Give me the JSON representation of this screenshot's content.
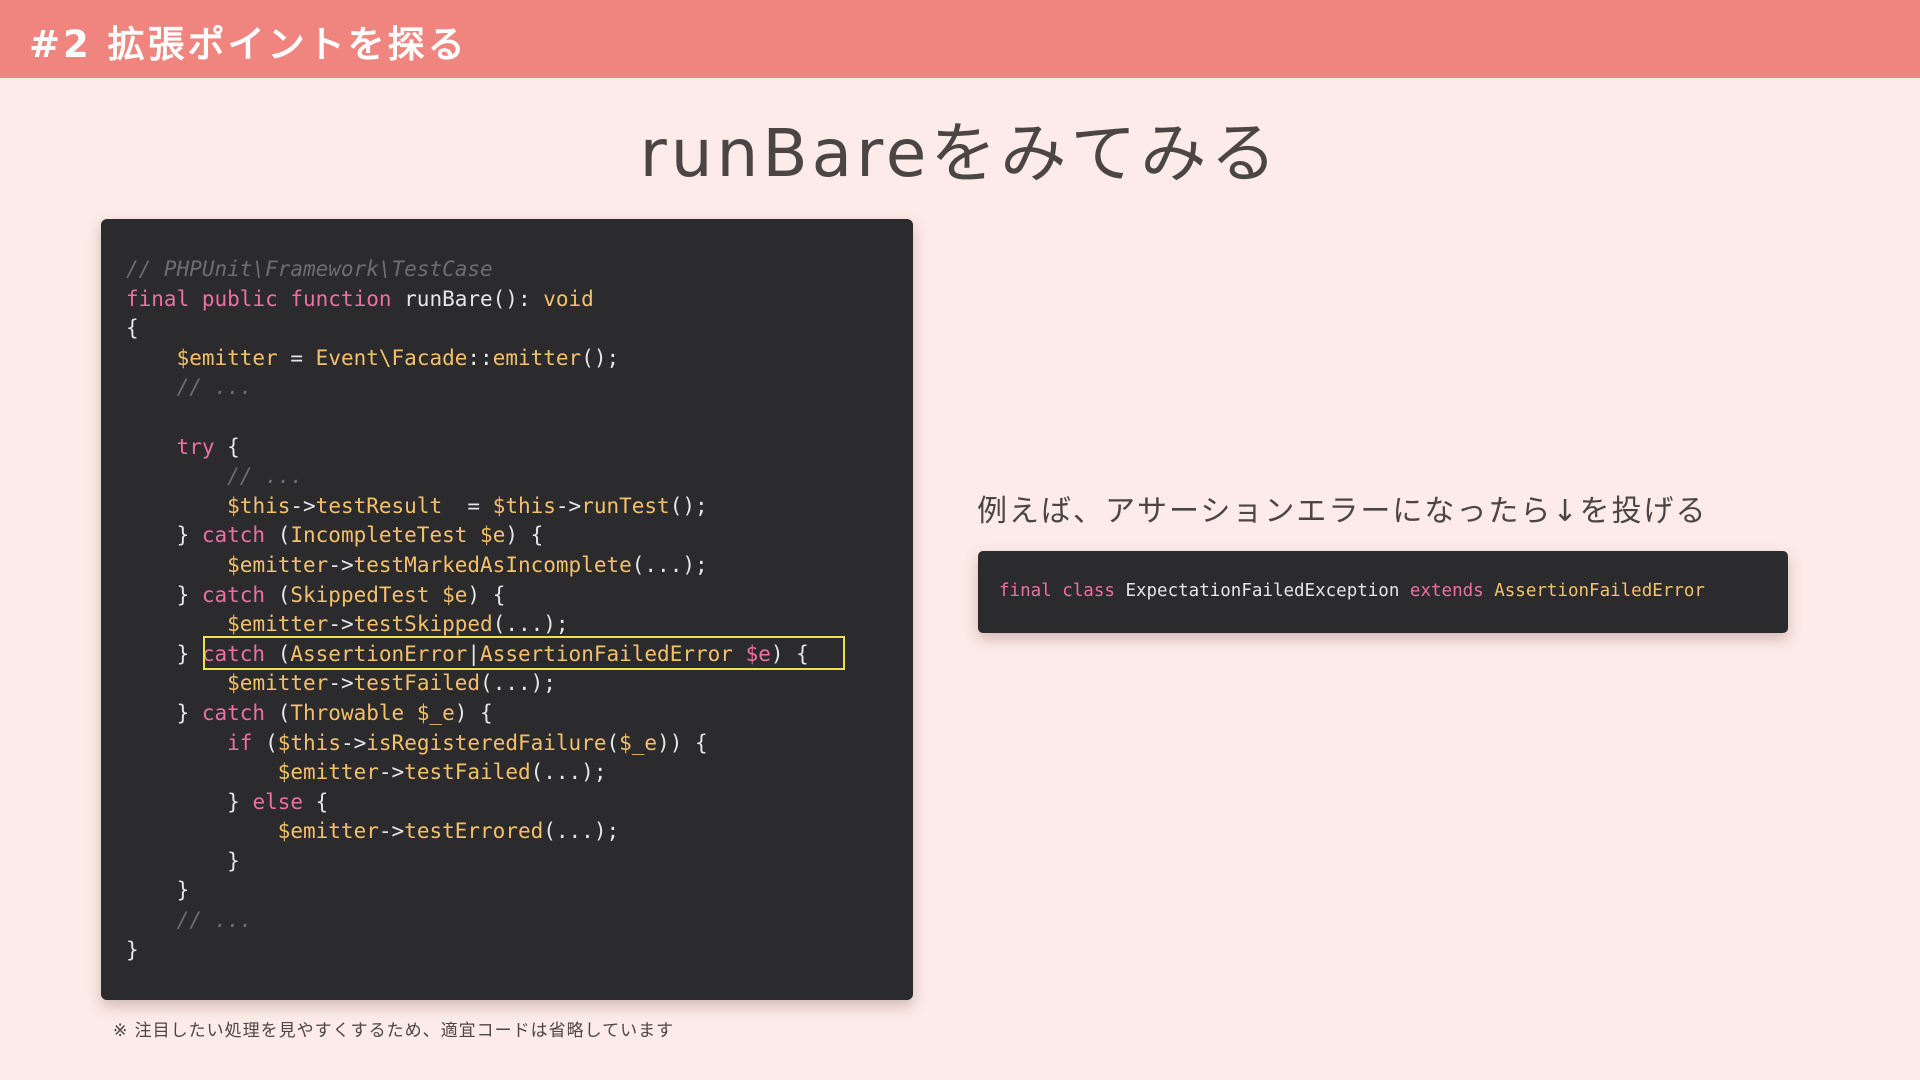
{
  "header": {
    "title": "#2 拡張ポイントを探る"
  },
  "slide": {
    "title": "runBareをみてみる"
  },
  "code_panel": {
    "lines": [
      [
        {
          "t": "// PHPUnit\\Framework\\TestCase",
          "c": "c"
        }
      ],
      [
        {
          "t": "final public function ",
          "c": "k"
        },
        {
          "t": "runBare(): ",
          "c": "p"
        },
        {
          "t": "void",
          "c": "f"
        }
      ],
      [
        {
          "t": "{",
          "c": "p"
        }
      ],
      [
        {
          "t": "    ",
          "c": "p"
        },
        {
          "t": "$emitter",
          "c": "f"
        },
        {
          "t": " = ",
          "c": "p"
        },
        {
          "t": "Event\\Facade",
          "c": "f"
        },
        {
          "t": "::",
          "c": "p"
        },
        {
          "t": "emitter",
          "c": "f"
        },
        {
          "t": "();",
          "c": "p"
        }
      ],
      [
        {
          "t": "    ",
          "c": "p"
        },
        {
          "t": "// ...",
          "c": "c"
        }
      ],
      [],
      [
        {
          "t": "    ",
          "c": "p"
        },
        {
          "t": "try",
          "c": "k"
        },
        {
          "t": " {",
          "c": "p"
        }
      ],
      [
        {
          "t": "        ",
          "c": "p"
        },
        {
          "t": "// ...",
          "c": "c"
        }
      ],
      [
        {
          "t": "        ",
          "c": "p"
        },
        {
          "t": "$this",
          "c": "f"
        },
        {
          "t": "->",
          "c": "p"
        },
        {
          "t": "testResult",
          "c": "f"
        },
        {
          "t": "  = ",
          "c": "p"
        },
        {
          "t": "$this",
          "c": "f"
        },
        {
          "t": "->",
          "c": "p"
        },
        {
          "t": "runTest",
          "c": "f"
        },
        {
          "t": "();",
          "c": "p"
        }
      ],
      [
        {
          "t": "    } ",
          "c": "p"
        },
        {
          "t": "catch",
          "c": "k"
        },
        {
          "t": " (",
          "c": "p"
        },
        {
          "t": "IncompleteTest",
          "c": "f"
        },
        {
          "t": " ",
          "c": "p"
        },
        {
          "t": "$e",
          "c": "f"
        },
        {
          "t": ") {",
          "c": "p"
        }
      ],
      [
        {
          "t": "        ",
          "c": "p"
        },
        {
          "t": "$emitter",
          "c": "f"
        },
        {
          "t": "->",
          "c": "p"
        },
        {
          "t": "testMarkedAsIncomplete",
          "c": "f"
        },
        {
          "t": "(...);",
          "c": "p"
        }
      ],
      [
        {
          "t": "    } ",
          "c": "p"
        },
        {
          "t": "catch",
          "c": "k"
        },
        {
          "t": " (",
          "c": "p"
        },
        {
          "t": "SkippedTest",
          "c": "f"
        },
        {
          "t": " ",
          "c": "p"
        },
        {
          "t": "$e",
          "c": "f"
        },
        {
          "t": ") {",
          "c": "p"
        }
      ],
      [
        {
          "t": "        ",
          "c": "p"
        },
        {
          "t": "$emitter",
          "c": "f"
        },
        {
          "t": "->",
          "c": "p"
        },
        {
          "t": "testSkipped",
          "c": "f"
        },
        {
          "t": "(...);",
          "c": "p"
        }
      ],
      [
        {
          "t": "    } ",
          "c": "p"
        },
        {
          "t": "catch",
          "c": "k"
        },
        {
          "t": " (",
          "c": "p"
        },
        {
          "t": "AssertionError",
          "c": "f"
        },
        {
          "t": "|",
          "c": "p"
        },
        {
          "t": "AssertionFailedError",
          "c": "f"
        },
        {
          "t": " ",
          "c": "p"
        },
        {
          "t": "$e",
          "c": "k"
        },
        {
          "t": ") {",
          "c": "p"
        }
      ],
      [
        {
          "t": "        ",
          "c": "p"
        },
        {
          "t": "$emitter",
          "c": "f"
        },
        {
          "t": "->",
          "c": "p"
        },
        {
          "t": "testFailed",
          "c": "f"
        },
        {
          "t": "(...);",
          "c": "p"
        }
      ],
      [
        {
          "t": "    } ",
          "c": "p"
        },
        {
          "t": "catch",
          "c": "k"
        },
        {
          "t": " (",
          "c": "p"
        },
        {
          "t": "Throwable",
          "c": "f"
        },
        {
          "t": " ",
          "c": "p"
        },
        {
          "t": "$_e",
          "c": "f"
        },
        {
          "t": ") {",
          "c": "p"
        }
      ],
      [
        {
          "t": "        ",
          "c": "p"
        },
        {
          "t": "if",
          "c": "k"
        },
        {
          "t": " (",
          "c": "p"
        },
        {
          "t": "$this",
          "c": "f"
        },
        {
          "t": "->",
          "c": "p"
        },
        {
          "t": "isRegisteredFailure",
          "c": "f"
        },
        {
          "t": "(",
          "c": "p"
        },
        {
          "t": "$_e",
          "c": "f"
        },
        {
          "t": ")) {",
          "c": "p"
        }
      ],
      [
        {
          "t": "            ",
          "c": "p"
        },
        {
          "t": "$emitter",
          "c": "f"
        },
        {
          "t": "->",
          "c": "p"
        },
        {
          "t": "testFailed",
          "c": "f"
        },
        {
          "t": "(...);",
          "c": "p"
        }
      ],
      [
        {
          "t": "        } ",
          "c": "p"
        },
        {
          "t": "else",
          "c": "k"
        },
        {
          "t": " {",
          "c": "p"
        }
      ],
      [
        {
          "t": "            ",
          "c": "p"
        },
        {
          "t": "$emitter",
          "c": "f"
        },
        {
          "t": "->",
          "c": "p"
        },
        {
          "t": "testErrored",
          "c": "f"
        },
        {
          "t": "(...);",
          "c": "p"
        }
      ],
      [
        {
          "t": "        }",
          "c": "p"
        }
      ],
      [
        {
          "t": "    }",
          "c": "p"
        }
      ],
      [
        {
          "t": "    ",
          "c": "p"
        },
        {
          "t": "// ...",
          "c": "c"
        }
      ],
      [
        {
          "t": "}",
          "c": "p"
        }
      ]
    ]
  },
  "footnote": "※ 注目したい処理を見やすくするため、適宜コードは省略しています",
  "side_text": "例えば、アサーションエラーになったら↓を投げる",
  "exception_panel": {
    "lines": [
      [
        {
          "t": "final class ",
          "c": "k"
        },
        {
          "t": "ExpectationFailedException ",
          "c": "p"
        },
        {
          "t": "extends ",
          "c": "k"
        },
        {
          "t": "AssertionFailedError",
          "c": "f"
        }
      ]
    ]
  },
  "colors": {
    "header_bg": "#f0857f",
    "page_bg": "#fcebe8",
    "code_bg": "#2b2b2d",
    "keyword": "#ee6fa4",
    "function": "#f5c06a",
    "comment": "#6e6e70",
    "highlight": "#ece34a"
  }
}
